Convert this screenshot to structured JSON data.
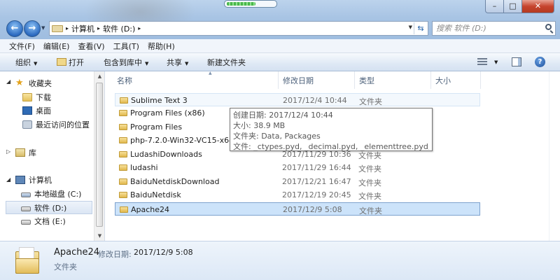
{
  "window": {
    "minimize_label": "–",
    "maximize_label": "□",
    "close_label": "✕",
    "loading_progress": 0.6
  },
  "nav": {
    "back_label": "←",
    "forward_label": "→",
    "dropdown_label": "▼"
  },
  "address": {
    "arrow": "▸",
    "crumbs": [
      "计算机",
      "软件 (D:)"
    ],
    "dropdown_label": "▼",
    "refresh_label": "⇆"
  },
  "search": {
    "placeholder": "搜索 软件 (D:)"
  },
  "menu": {
    "items": [
      "文件(F)",
      "编辑(E)",
      "查看(V)",
      "工具(T)",
      "帮助(H)"
    ]
  },
  "toolbar": {
    "organize": "组织",
    "open": "打开",
    "include_library": "包含到库中",
    "share": "共享",
    "new_folder": "新建文件夹",
    "dropdown": "▼",
    "help": "?"
  },
  "sidebar": {
    "expanded_arrow": "◢",
    "collapsed_arrow": "▷",
    "scroll_up": "▲",
    "scroll_down": "▼",
    "favorites": "收藏夹",
    "favorites_items": [
      "下载",
      "桌面",
      "最近访问的位置"
    ],
    "library": "库",
    "computer": "计算机",
    "drives": [
      "本地磁盘 (C:)",
      "软件 (D:)",
      "文档 (E:)"
    ]
  },
  "columns": {
    "name": "名称",
    "date": "修改日期",
    "type": "类型",
    "size": "大小",
    "sort_indicator": "▲"
  },
  "files": [
    {
      "name": "Sublime Text 3",
      "date": "2017/12/4 10:44",
      "type": "文件夹"
    },
    {
      "name": "Program Files (x86)",
      "date": "",
      "type": ""
    },
    {
      "name": "Program Files",
      "date": "",
      "type": ""
    },
    {
      "name": "php-7.2.0-Win32-VC15-x64",
      "date": "",
      "type": ""
    },
    {
      "name": "LudashiDownloads",
      "date": "2017/11/29 10:36",
      "type": "文件夹"
    },
    {
      "name": "ludashi",
      "date": "2017/11/29 16:44",
      "type": "文件夹"
    },
    {
      "name": "BaiduNetdiskDownload",
      "date": "2017/12/21 16:47",
      "type": "文件夹"
    },
    {
      "name": "BaiduNetdisk",
      "date": "2017/12/19 20:45",
      "type": "文件夹"
    },
    {
      "name": "Apache24",
      "date": "2017/12/9 5:08",
      "type": "文件夹"
    }
  ],
  "tooltip": {
    "lines": [
      "创建日期: 2017/12/4 10:44",
      "大小: 38.9 MB",
      "文件夹: Data, Packages",
      "文件: _ctypes.pyd, _decimal.pyd, _elementtree.pyd, ..."
    ]
  },
  "details": {
    "name": "Apache24",
    "modified_label": "修改日期:",
    "modified_value": "2017/12/9 5:08",
    "type": "文件夹"
  }
}
